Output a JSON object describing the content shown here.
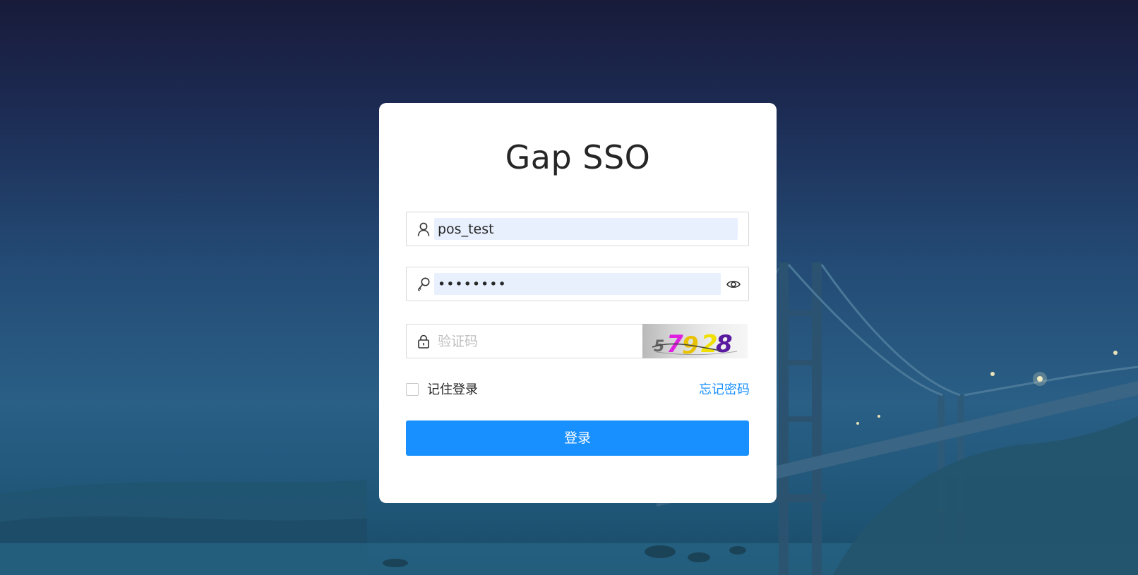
{
  "app": {
    "title": "Gap SSO"
  },
  "form": {
    "username": {
      "value": "pos_test",
      "icon": "user-icon"
    },
    "password": {
      "value": "••••••••",
      "icon": "key-icon",
      "toggle_icon": "eye-icon"
    },
    "captcha": {
      "placeholder": "验证码",
      "icon": "lock-icon",
      "image_text": "57928"
    },
    "remember_label": "记住登录",
    "remember_checked": false,
    "forgot_label": "忘记密码",
    "submit_label": "登录"
  },
  "colors": {
    "primary": "#1890ff",
    "autofill": "#e8f0fe",
    "card": "#ffffff"
  }
}
